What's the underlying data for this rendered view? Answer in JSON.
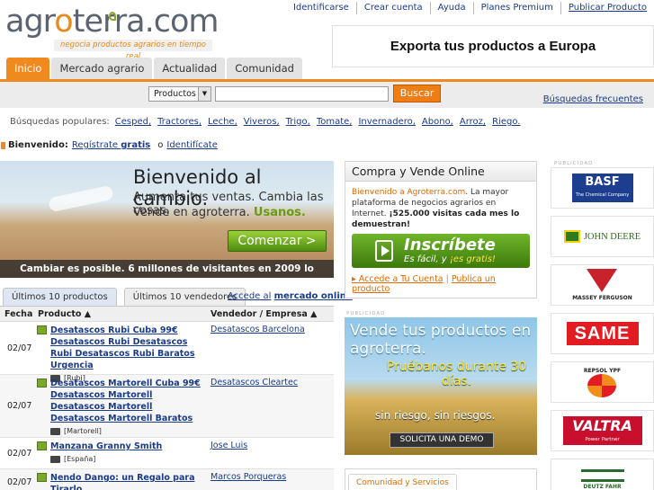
{
  "header": {
    "logo_text_a": "agr",
    "logo_text_b": "o",
    "logo_text_c": "terra.com",
    "tagline": "negocia productos agrarios en tiempo real",
    "top_links": [
      "Identificarse",
      "Crear cuenta",
      "Ayuda",
      "Planes Premium",
      "Publicar Producto"
    ],
    "promo": "Exporta tus productos a Europa"
  },
  "nav": {
    "tabs": [
      "Inicio",
      "Mercado agrario",
      "Actualidad",
      "Comunidad"
    ],
    "active_tab": "Inicio"
  },
  "search": {
    "category": "Productos",
    "input_value": "",
    "button": "Buscar",
    "frequent": "Búsquedas frecuentes"
  },
  "popular": {
    "label": "Búsquedas populares:",
    "items": [
      "Cesped,",
      "Tractores,",
      "Leche,",
      "Viveros,",
      "Trigo,",
      "Tomate,",
      "Invernadero,",
      "Abono,",
      "Arroz,",
      "Riego."
    ]
  },
  "welcome": {
    "label": "Bienvenido:",
    "register_a": "Regístrate",
    "register_b": "gratis",
    "or": "o",
    "login": "Identifícate"
  },
  "banner": {
    "title": "Bienvenido al cambio.",
    "line2": "Aumenta tus ventas. Cambia las cosas.",
    "line3a": "Vende en agroterra.",
    "line3b": "Usanos.",
    "cta": "Comenzar >",
    "strip": "Cambiar es posible. 6 millones de visitantes en 2009 lo demuestran."
  },
  "products": {
    "tabs": [
      "Últimos 10 productos",
      "Últimos 10 vendedores"
    ],
    "market_link_a": "Accede al",
    "market_link_b": "mercado online",
    "columns": [
      "Fecha",
      "Producto ▲",
      "Vendedor / Empresa ▲"
    ],
    "rows": [
      {
        "date": "02/07",
        "product": "Desatascos Rubi Cuba 99€ Desatascos Rubi Desatascos Rubi Desatascos Rubi Baratos Urgencia",
        "location": "[Rubi]",
        "seller": "Desatascos Barcelona"
      },
      {
        "date": "02/07",
        "product": "Desatascos Martorell Cuba 99€ Desatascos Martorell Desatascos Martorell Desatascos Martorell Baratos",
        "location": "[Martorell]",
        "seller": "Desatascos Cleartec"
      },
      {
        "date": "02/07",
        "product": "Manzana Granny Smith",
        "location": "[España]",
        "seller": "Jose Luis"
      },
      {
        "date": "02/07",
        "product": "Nendo Dango: un Regalo para Tirarlo",
        "location": "",
        "seller": "Marcos Porqueras"
      }
    ]
  },
  "buysell": {
    "title": "Compra y Vende Online",
    "intro_a": "Bienvenido a Agroterra.com",
    "intro_b": ". La mayor plataforma de negocios agrarios en Internet.",
    "intro_c": "¡525.000 visitas cada mes lo demuestran!",
    "signup_title": "Inscríbete",
    "signup_sub_a": "Es fácil, y",
    "signup_sub_b": "¡es gratis!",
    "link1": "Accede a Tu Cuenta",
    "link2": "Publica un producto"
  },
  "publicidad_label": "PUBLICIDAD",
  "banner2": {
    "line1": "Vende tus productos en agroterra.",
    "line2": "Pruébanos durante 30 días.",
    "line3": "sin riesgo, sin riesgos.",
    "demo": "SOLICITA UNA DEMO"
  },
  "community": {
    "tab": "Comunidad y Servicios"
  },
  "brands": [
    {
      "name": "BASF",
      "sub": "The Chemical Company"
    },
    {
      "name": "JOHN DEERE"
    },
    {
      "name": "MASSEY FERGUSON"
    },
    {
      "name": "SAME"
    },
    {
      "name": "REPSOL YPF"
    },
    {
      "name": "VALTRA",
      "sub": "Power Partner"
    },
    {
      "name": "DEUTZ FAHR"
    }
  ]
}
